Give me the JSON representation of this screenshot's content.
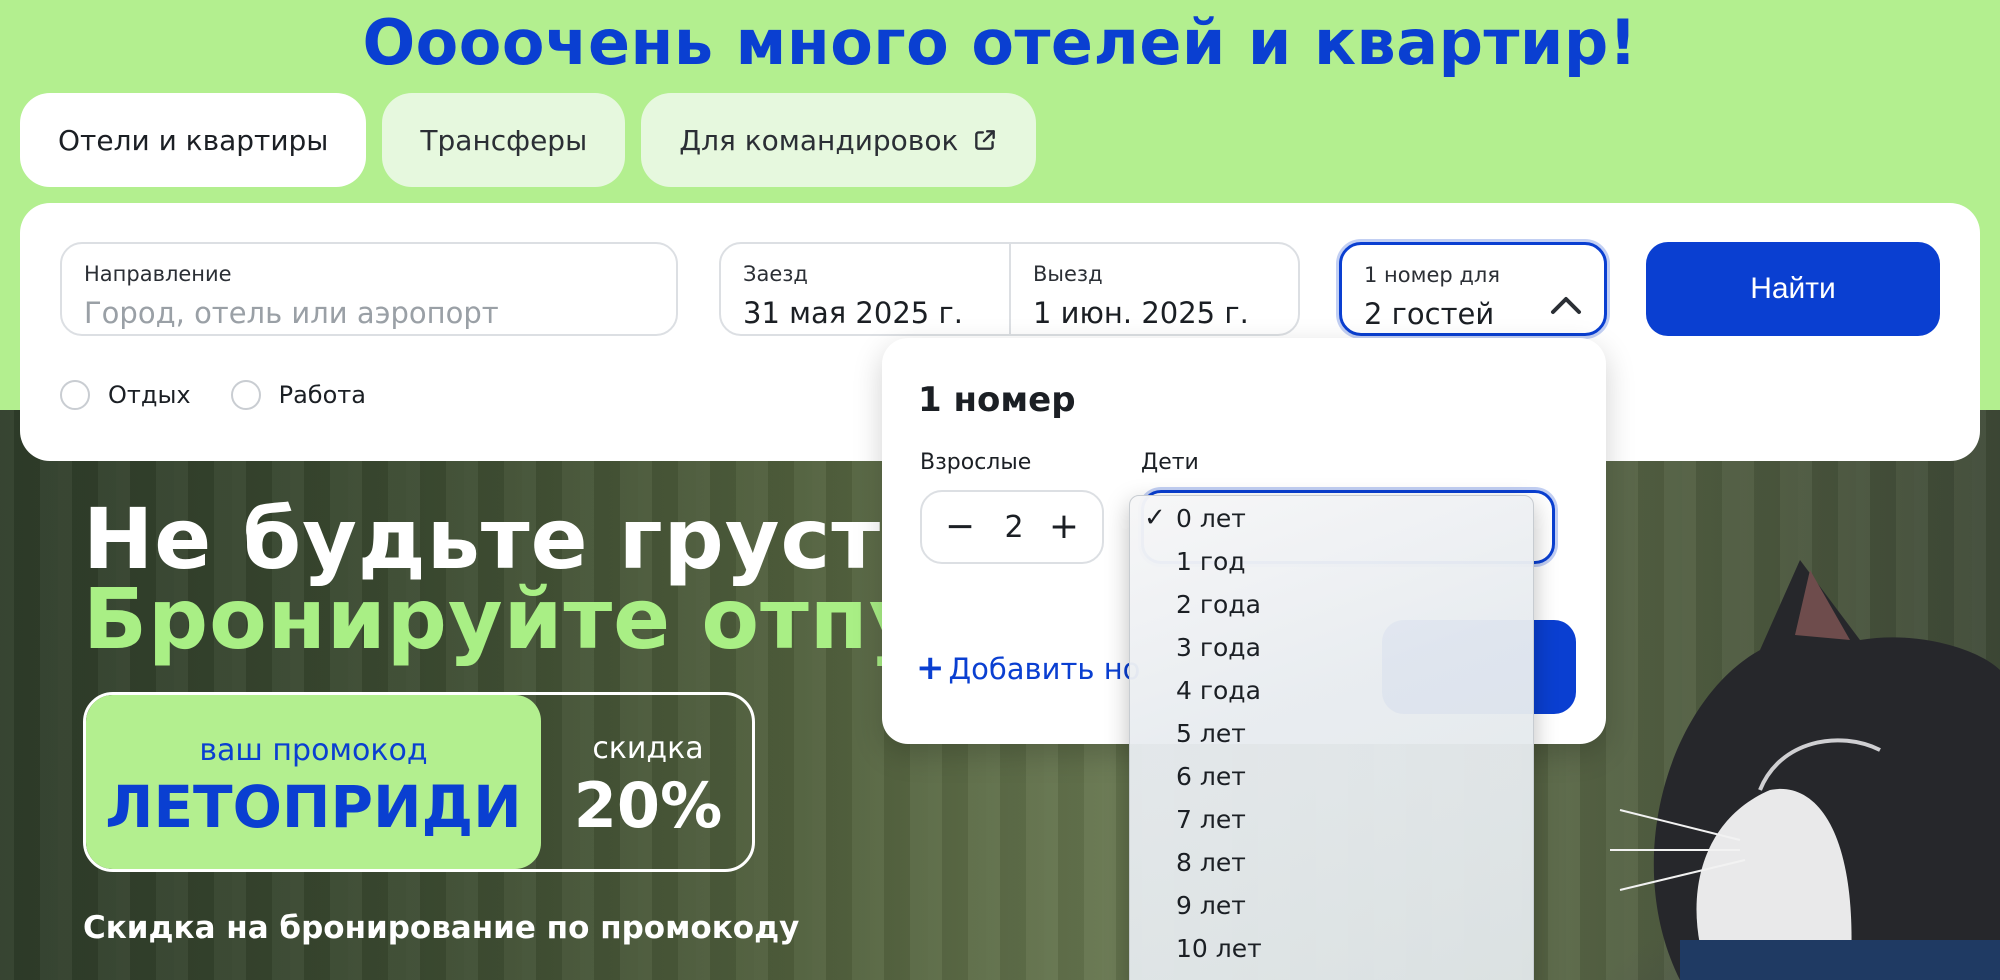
{
  "title": "Оооочень много отелей и квартир!",
  "tabs": [
    {
      "label": "Отели и квартиры",
      "active": true
    },
    {
      "label": "Трансферы",
      "active": false
    },
    {
      "label": "Для командировок",
      "active": false,
      "icon": "external-link-icon"
    }
  ],
  "search": {
    "destination_label": "Направление",
    "destination_placeholder": "Город, отель или аэропорт",
    "checkin_label": "Заезд",
    "checkin_value": "31 мая 2025 г.",
    "checkout_label": "Выезд",
    "checkout_value": "1 июн. 2025 г.",
    "guests_label": "1 номер для",
    "guests_value": "2 гостей",
    "find_label": "Найти",
    "trip_types": [
      "Отдых",
      "Работа"
    ]
  },
  "promo": {
    "headline1": "Не будьте грустны",
    "headline2": "Бронируйте отпуск",
    "code_label": "ваш промокод",
    "code": "ЛЕТОПРИДИ",
    "discount_label": "скидка",
    "discount": "20%",
    "subtitle": "Скидка на бронирование по промокоду"
  },
  "guests_popup": {
    "title": "1 номер",
    "adults_label": "Взрослые",
    "adults_value": "2",
    "minus": "−",
    "plus": "+",
    "kids_label": "Дети",
    "add_room": "Добавить но"
  },
  "kids_age_options": {
    "selected_index": 0,
    "items": [
      "0 лет",
      "1 год",
      "2 года",
      "3 года",
      "4 года",
      "5 лет",
      "6 лет",
      "7 лет",
      "8 лет",
      "9 лет",
      "10 лет"
    ]
  },
  "colors": {
    "accent": "#0a3fd1",
    "brand_green": "#b3ef8f"
  }
}
